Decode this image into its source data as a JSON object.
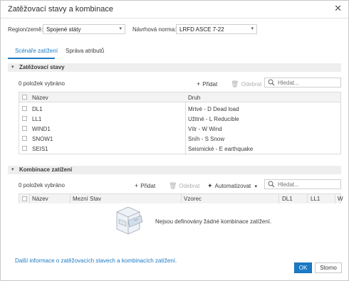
{
  "dialog": {
    "title": "Zatěžovací stavy a kombinace",
    "close_glyph": "✕"
  },
  "filters": {
    "region_label": "Region/země:",
    "region_value": "Spojené státy",
    "norm_label": "Návrhová norma:",
    "norm_value": "LRFD ASCE 7-22"
  },
  "tabs": [
    {
      "label": "Scénáře zatížení",
      "active": true
    },
    {
      "label": "Správa atributů",
      "active": false
    }
  ],
  "load_cases": {
    "header": "Zatěžovací stavy",
    "count_text": "0 položek vybráno",
    "add_label": "Přidat",
    "remove_label": "Odebrat",
    "search_placeholder": "Hledat...",
    "columns": [
      "Název",
      "Druh"
    ],
    "rows": [
      {
        "name": "DL1",
        "kind": "Mrtvé - D Dead load"
      },
      {
        "name": "LL1",
        "kind": "Užitné - L Reducible"
      },
      {
        "name": "WIND1",
        "kind": "Vítr - W Wind"
      },
      {
        "name": "SNOW1",
        "kind": "Sníh - S Snow"
      },
      {
        "name": "SEIS1",
        "kind": "Seismické - E earthquake"
      }
    ]
  },
  "combinations": {
    "header": "Kombinace zatížení",
    "count_text": "0 položek vybráno",
    "add_label": "Přidat",
    "remove_label": "Odebrat",
    "automate_label": "Automatizovat",
    "search_placeholder": "Hledat...",
    "columns": [
      "Název",
      "Mezní Stav",
      "Vzorec",
      "DL1",
      "LL1",
      "W"
    ],
    "empty_message": "Nejsou definovány žádné kombinace zatížení."
  },
  "footer": {
    "info_link": "Další informace o zatěžovacích stavech a kombinacích zatížení.",
    "ok_label": "OK",
    "cancel_label": "Storno"
  },
  "colors": {
    "accent": "#1b7ac4",
    "section_bg": "#eeeeee",
    "disabled_text": "#b0b0b0"
  }
}
